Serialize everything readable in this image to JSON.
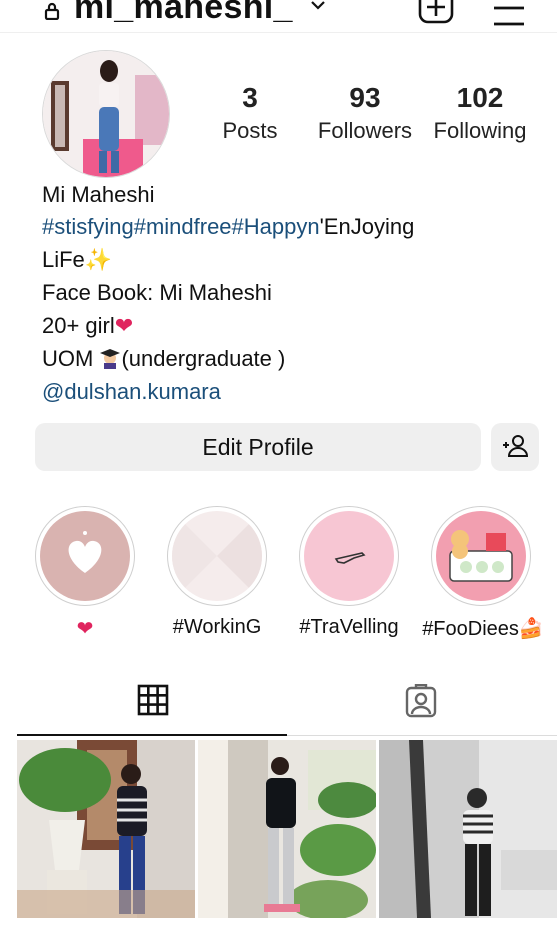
{
  "header": {
    "username": "mi_maheshi_",
    "icons": [
      "lock-icon",
      "chevron-down-icon",
      "add-post-icon",
      "menu-icon"
    ]
  },
  "stats": {
    "posts": {
      "value": "3",
      "label": "Posts"
    },
    "followers": {
      "value": "93",
      "label": "Followers"
    },
    "following": {
      "value": "102",
      "label": "Following"
    }
  },
  "bio": {
    "name": "Mi Maheshi",
    "hashtags": "#stisfying#mindfree#Happyn",
    "line1_rest": "'EnJoying",
    "line2": "LiFe",
    "line3": "Face Book: Mi Maheshi",
    "line4": "20+ girl",
    "line5_a": "UOM ",
    "line5_b": "(undergraduate )",
    "mention": "@dulshan.kumara"
  },
  "buttons": {
    "edit_profile": "Edit Profile"
  },
  "highlights": [
    {
      "label": "",
      "emoji_after": "❤️"
    },
    {
      "label": "#WorkinG"
    },
    {
      "label": "#TraVelling"
    },
    {
      "label": "#FooDiees"
    }
  ],
  "tabs": [
    "grid-icon",
    "tagged-icon"
  ],
  "colors": {
    "link": "#1b4f7a",
    "button_bg": "#efefef",
    "highlight1": "#d9b3b0",
    "highlight3": "#f7c6d3"
  }
}
